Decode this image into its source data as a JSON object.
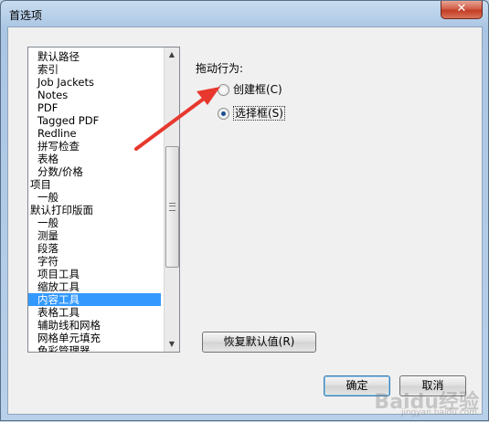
{
  "window": {
    "title": "首选项",
    "close_glyph": "✕"
  },
  "list": {
    "items": [
      {
        "label": "默认路径",
        "level": 1
      },
      {
        "label": "索引",
        "level": 1
      },
      {
        "label": "Job Jackets",
        "level": 1
      },
      {
        "label": "Notes",
        "level": 1
      },
      {
        "label": "PDF",
        "level": 1
      },
      {
        "label": "Tagged PDF",
        "level": 1
      },
      {
        "label": "Redline",
        "level": 1
      },
      {
        "label": "拼写检查",
        "level": 1
      },
      {
        "label": "表格",
        "level": 1
      },
      {
        "label": "分数/价格",
        "level": 1
      },
      {
        "label": "项目",
        "level": 0
      },
      {
        "label": "一般",
        "level": 1
      },
      {
        "label": "默认打印版面",
        "level": 0
      },
      {
        "label": "一般",
        "level": 1
      },
      {
        "label": "测量",
        "level": 1
      },
      {
        "label": "段落",
        "level": 1
      },
      {
        "label": "字符",
        "level": 1
      },
      {
        "label": "项目工具",
        "level": 1
      },
      {
        "label": "缩放工具",
        "level": 1
      },
      {
        "label": "内容工具",
        "level": 1,
        "selected": true
      },
      {
        "label": "表格工具",
        "level": 1
      },
      {
        "label": "辅助线和网格",
        "level": 1
      },
      {
        "label": "网格单元填充",
        "level": 1
      },
      {
        "label": "色彩管理器",
        "level": 1
      }
    ],
    "scroll_up_glyph": "▲",
    "scroll_down_glyph": "▼"
  },
  "drag_behavior": {
    "label": "拖动行为:",
    "options": [
      {
        "label": "创建框(C)",
        "checked": false
      },
      {
        "label": "选择框(S)",
        "checked": true
      }
    ]
  },
  "buttons": {
    "restore_defaults": "恢复默认值(R)",
    "ok": "确定",
    "cancel": "取消"
  },
  "annotation": {
    "arrow_color": "#e8382e"
  },
  "watermark": {
    "text": "Baidu经验",
    "sub": "jingyan.baidu.com"
  }
}
